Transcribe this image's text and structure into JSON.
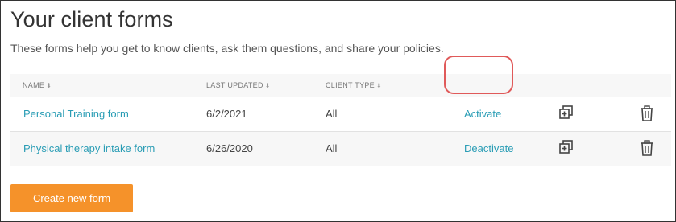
{
  "page": {
    "title": "Your client forms",
    "subtitle": "These forms help you get to know clients, ask them questions, and share your policies."
  },
  "table": {
    "columns": [
      "NAME",
      "LAST UPDATED",
      "CLIENT TYPE"
    ],
    "sort_icon": "sort-arrows-icon",
    "rows": [
      {
        "name": "Personal Training form",
        "updated": "6/2/2021",
        "client_type": "All",
        "action": "Activate"
      },
      {
        "name": "Physical therapy intake form",
        "updated": "6/26/2020",
        "client_type": "All",
        "action": "Deactivate"
      }
    ],
    "row_icons": [
      "duplicate-icon",
      "trash-icon"
    ]
  },
  "actions": {
    "create_label": "Create new form"
  },
  "colors": {
    "link": "#2a9db5",
    "primary_button": "#f5922a",
    "highlight": "#e05a5a"
  }
}
